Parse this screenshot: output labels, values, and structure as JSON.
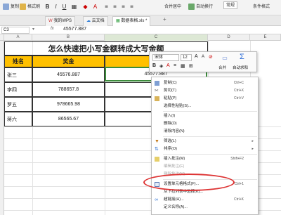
{
  "ribbon": {
    "copy_label": "复制",
    "format_painter_label": "格式刷",
    "font_bold": "B",
    "font_italic": "I",
    "font_underline": "U",
    "merge_center_label": "合并居中",
    "wrap_text_label": "自动换行",
    "format_label": "常规",
    "conditional_format_label": "条件格式"
  },
  "tabs": [
    {
      "label": "我的WPS"
    },
    {
      "label": "云文档"
    },
    {
      "label": "数据表格.xls *"
    }
  ],
  "formula_bar": {
    "cell_ref": "C3",
    "fx_symbol": "fx",
    "value": "45577.887"
  },
  "columns": [
    "A",
    "B",
    "C",
    "D",
    "E"
  ],
  "rows": [
    "1",
    "2",
    "3",
    "4",
    "5",
    "6",
    "7",
    "8",
    "9",
    "10",
    "11",
    "12",
    "13",
    "14",
    "15",
    "16",
    "17"
  ],
  "sheet": {
    "title": "怎么快速把小写金额转成大写金额",
    "headers": [
      "姓名",
      "奖金",
      "大写"
    ],
    "data": [
      {
        "name": "张三",
        "amount": "45576.887",
        "upper": "45577.887"
      },
      {
        "name": "李四",
        "amount": "788657.8",
        "upper": ""
      },
      {
        "name": "罗五",
        "amount": "978665.98",
        "upper": ""
      },
      {
        "name": "蒋六",
        "amount": "86565.67",
        "upper": ""
      }
    ]
  },
  "mini_toolbar": {
    "font_name": "宋体",
    "font_size": "12",
    "merge_label": "合并",
    "autosum_label": "自动求和"
  },
  "context_menu": {
    "items": [
      {
        "label": "复制(C)",
        "key": "Ctrl+C",
        "icon": "copy-icon",
        "disabled": false,
        "submenu": false
      },
      {
        "label": "剪切(T)",
        "key": "Ctrl+X",
        "icon": "cut-icon",
        "disabled": false,
        "submenu": false
      },
      {
        "label": "粘贴(P)",
        "key": "Ctrl+V",
        "icon": "paste-icon",
        "disabled": false,
        "submenu": false
      },
      {
        "label": "选择性粘贴(S)...",
        "key": "",
        "icon": "",
        "disabled": false,
        "submenu": false
      },
      {
        "label": "插入(I)",
        "key": "",
        "icon": "",
        "disabled": false,
        "submenu": false
      },
      {
        "label": "删除(D)",
        "key": "",
        "icon": "",
        "disabled": false,
        "submenu": false
      },
      {
        "label": "清除内容(N)",
        "key": "",
        "icon": "",
        "disabled": false,
        "submenu": false
      },
      {
        "label": "筛选(L)",
        "key": "",
        "icon": "filter-icon",
        "disabled": false,
        "submenu": true
      },
      {
        "label": "排序(O)",
        "key": "",
        "icon": "sort-icon",
        "disabled": false,
        "submenu": true
      },
      {
        "label": "插入批注(M)",
        "key": "Shift+F2",
        "icon": "comment-icon",
        "disabled": false,
        "submenu": false
      },
      {
        "label": "编辑批注(E)",
        "key": "",
        "icon": "",
        "disabled": true,
        "submenu": false
      },
      {
        "label": "删除批注(M)",
        "key": "",
        "icon": "",
        "disabled": true,
        "submenu": false
      },
      {
        "label": "设置单元格格式(F)...",
        "key": "Ctrl+1",
        "icon": "cell-format-icon",
        "disabled": false,
        "submenu": false
      },
      {
        "label": "从下拉列表中选择(K)...",
        "key": "",
        "icon": "",
        "disabled": false,
        "submenu": false
      },
      {
        "label": "超链接(H)...",
        "key": "Ctrl+K",
        "icon": "link-icon",
        "disabled": false,
        "submenu": false
      },
      {
        "label": "定义名称(A)...",
        "key": "",
        "icon": "",
        "disabled": false,
        "submenu": false
      }
    ]
  },
  "colors": {
    "header_fill": "#ffc000",
    "highlight_ellipse": "#dd3333",
    "selection_border": "#3c8c3c"
  }
}
